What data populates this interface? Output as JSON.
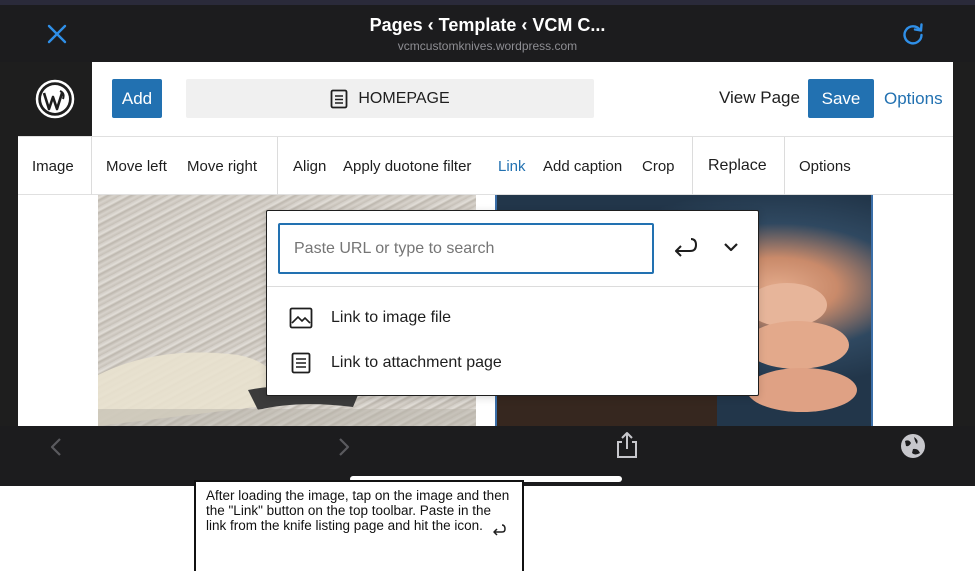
{
  "browser": {
    "title": "Pages ‹ Template ‹ VCM C...",
    "url": "vcmcustomknives.wordpress.com",
    "close_icon": "close-icon",
    "reload_icon": "reload-icon"
  },
  "header": {
    "add_label": "Add",
    "doc_title": "HOMEPAGE",
    "view_page_label": "View Page",
    "save_label": "Save",
    "options_label": "Options"
  },
  "toolbar": {
    "image": "Image",
    "move_left": "Move left",
    "move_right": "Move right",
    "align": "Align",
    "duotone": "Apply duotone filter",
    "link": "Link",
    "caption": "Add caption",
    "crop": "Crop",
    "replace": "Replace",
    "options": "Options"
  },
  "link_popover": {
    "placeholder": "Paste URL or type to search",
    "value": "",
    "options": [
      {
        "label": "Link to image file",
        "icon": "image-icon"
      },
      {
        "label": "Link to attachment page",
        "icon": "document-icon"
      }
    ]
  },
  "annotation": {
    "text": "After loading the image, tap on the image and then the \"Link\" button on the top toolbar. Paste in the link from the knife listing page and hit the icon."
  },
  "colors": {
    "accent": "#2271b1",
    "dark": "#1c1c1e"
  }
}
